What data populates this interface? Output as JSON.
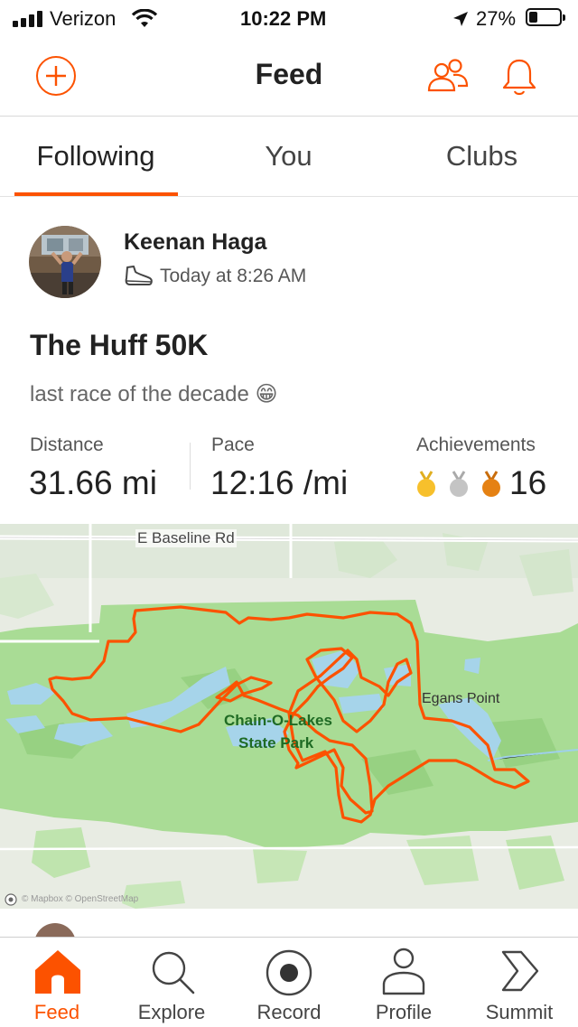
{
  "status_bar": {
    "carrier": "Verizon",
    "time": "10:22 PM",
    "battery": "27%"
  },
  "header": {
    "title": "Feed"
  },
  "tabs": [
    {
      "label": "Following",
      "active": true
    },
    {
      "label": "You",
      "active": false
    },
    {
      "label": "Clubs",
      "active": false
    }
  ],
  "activity": {
    "athlete_name": "Keenan Haga",
    "timestamp": "Today at 8:26 AM",
    "title": "The Huff 50K",
    "description": "last race of the decade 😁",
    "stats": {
      "distance_label": "Distance",
      "distance_value": "31.66 mi",
      "pace_label": "Pace",
      "pace_value": "12:16 /mi",
      "achievements_label": "Achievements",
      "achievements_value": "16"
    },
    "map": {
      "road_label": "E Baseline Rd",
      "park_label_line1": "Chain-O-Lakes",
      "park_label_line2": "State Park",
      "poi_label": "Egans Point",
      "attribution": "© Mapbox © OpenStreetMap"
    }
  },
  "bottom_nav": [
    {
      "label": "Feed",
      "icon": "home-icon",
      "active": true
    },
    {
      "label": "Explore",
      "icon": "search-icon",
      "active": false
    },
    {
      "label": "Record",
      "icon": "record-icon",
      "active": false
    },
    {
      "label": "Profile",
      "icon": "profile-icon",
      "active": false
    },
    {
      "label": "Summit",
      "icon": "summit-icon",
      "active": false
    }
  ],
  "colors": {
    "accent": "#fc5200",
    "map_green": "#a9dc95",
    "map_bg": "#e8ece3",
    "water": "#a6d4ea",
    "gold": "#f7c02c",
    "silver": "#c4c4c4",
    "bronze": "#e58113"
  }
}
